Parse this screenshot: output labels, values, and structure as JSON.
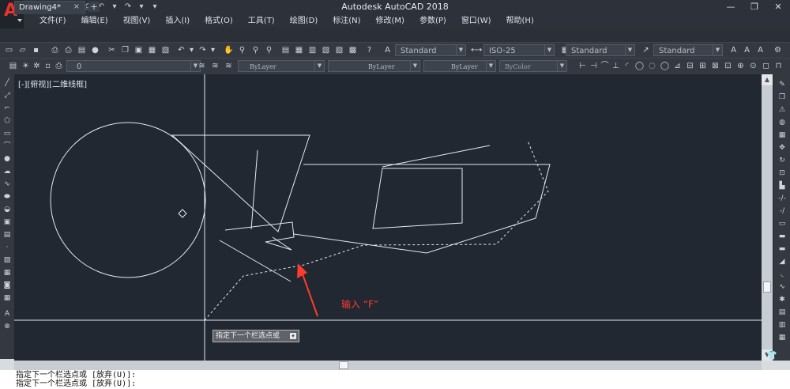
{
  "window": {
    "title": "Autodesk AutoCAD 2018",
    "controls": [
      "—",
      "❐",
      "✕"
    ]
  },
  "menu": {
    "items": [
      "文件(F)",
      "编辑(E)",
      "视图(V)",
      "插入(I)",
      "格式(O)",
      "工具(T)",
      "绘图(D)",
      "标注(N)",
      "修改(M)",
      "参数(P)",
      "窗口(W)",
      "帮助(H)"
    ]
  },
  "tabs": {
    "document": "Drawing4*",
    "close": "×",
    "new": "+"
  },
  "toolbar": {
    "text_style": "Standard",
    "dim_style": "ISO-25",
    "table_style": "Standard",
    "multileader_style": "Standard",
    "layer": "0",
    "color": "ByLayer",
    "linetype": "ByLayer",
    "lineweight": "ByLayer",
    "plot_style": "ByColor"
  },
  "viewport": {
    "label": "[-][俯视][二维线框]"
  },
  "tooltip": {
    "text": "指定下一个栏选点或"
  },
  "annotation": {
    "text": "输入 “F”",
    "color": "#ff3b30"
  },
  "command_line": {
    "lines": [
      "指定下一个栏选点或 [放弃(U)]:",
      "指定下一个栏选点或 [放弃(U)]:"
    ]
  },
  "colors": {
    "canvas": "#212831",
    "geometry": "#e6e9ee",
    "accent_logo": "#e8322b"
  }
}
